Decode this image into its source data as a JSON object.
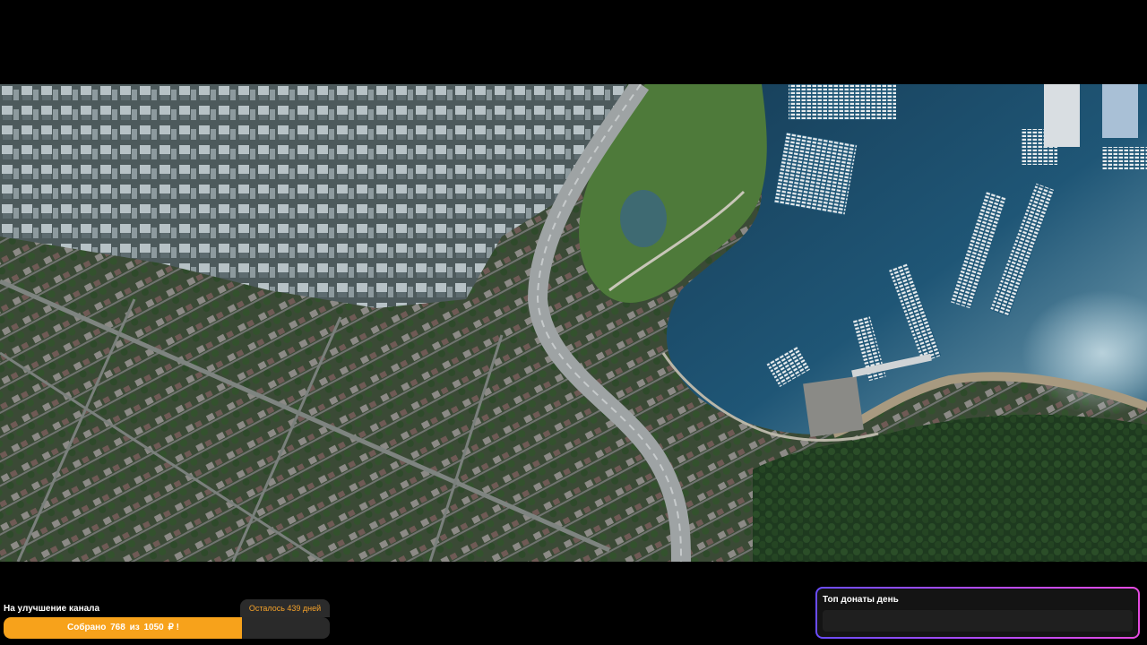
{
  "goal": {
    "title": "На улучшение канала",
    "remaining": "Осталось 439 дней",
    "collected_prefix": "Собрано",
    "collected": "768",
    "of_word": "из",
    "target": "1050",
    "currency": "₽ !",
    "progress": 0.7314,
    "bar_color": "#f7a21b"
  },
  "top_donations": {
    "title": "Топ донаты день"
  },
  "video": {
    "scene": "aerial city and marina"
  },
  "colors": {
    "water": "#1c4a66",
    "accent": "#b04bff"
  }
}
